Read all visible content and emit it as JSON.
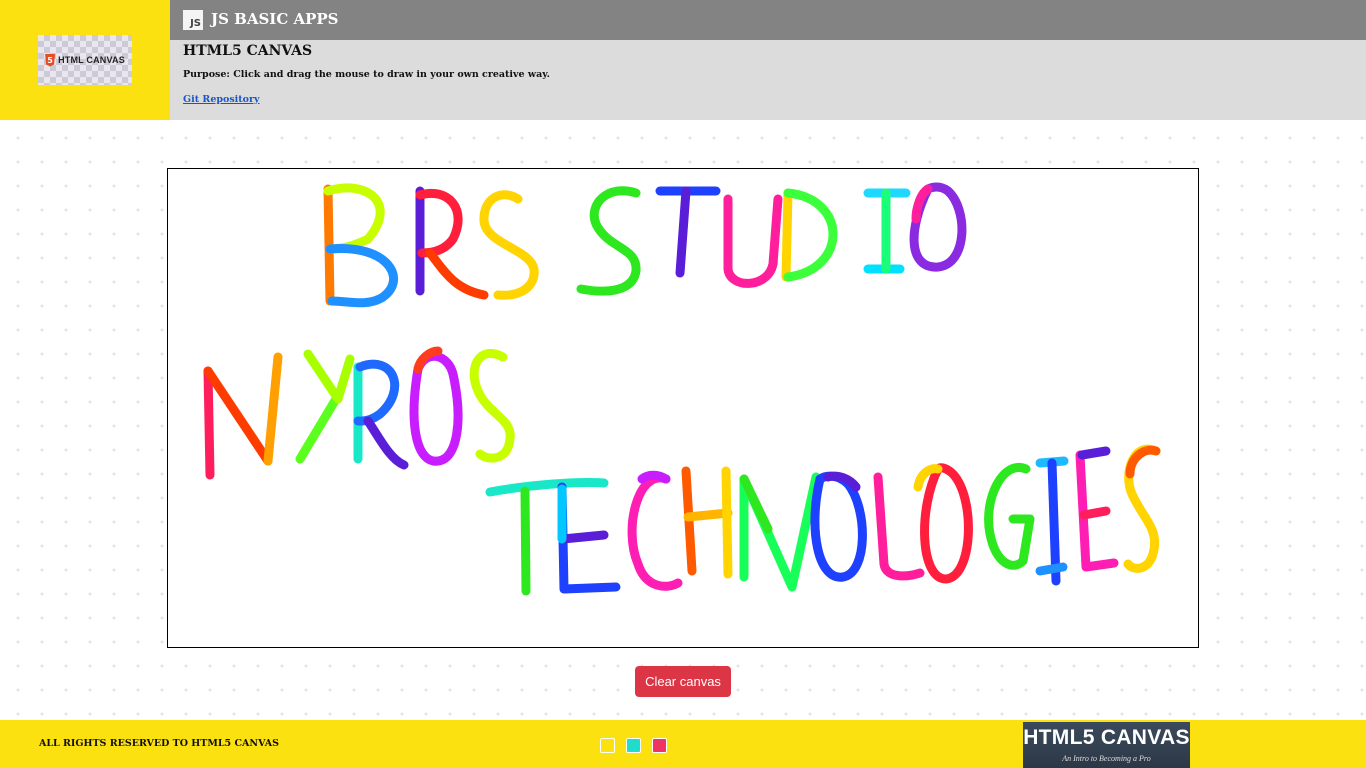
{
  "header": {
    "logo_text": "HTML CANVAS",
    "html5_badge": "5",
    "js_badge": "JS",
    "app_title": "JS BASIC APPS",
    "page_title": "HTML5 CANVAS",
    "purpose": "Purpose: Click and drag the mouse to draw in your own creative way.",
    "git_link": "Git Repository"
  },
  "canvas": {
    "drawing_text_lines": [
      "BRS STUDIO",
      "NYROS",
      "TECHNOLOGIES"
    ]
  },
  "controls": {
    "clear_label": "Clear canvas"
  },
  "footer": {
    "copyright": "ALL RIGHTS RESERVED TO HTML5 CANVAS",
    "swatches": [
      {
        "name": "yellow",
        "color": "#fbe10f"
      },
      {
        "name": "teal",
        "color": "#1fdccb"
      },
      {
        "name": "red",
        "color": "#ef3462"
      }
    ],
    "promo_title": "HTML5 CANVAS",
    "promo_subtitle": "An Intro to Becoming a Pro"
  },
  "colors": {
    "header_yellow": "#fbe10f",
    "topbar_gray": "#838383",
    "infobar_gray": "#dcdcdc",
    "button_red": "#dc3545"
  }
}
